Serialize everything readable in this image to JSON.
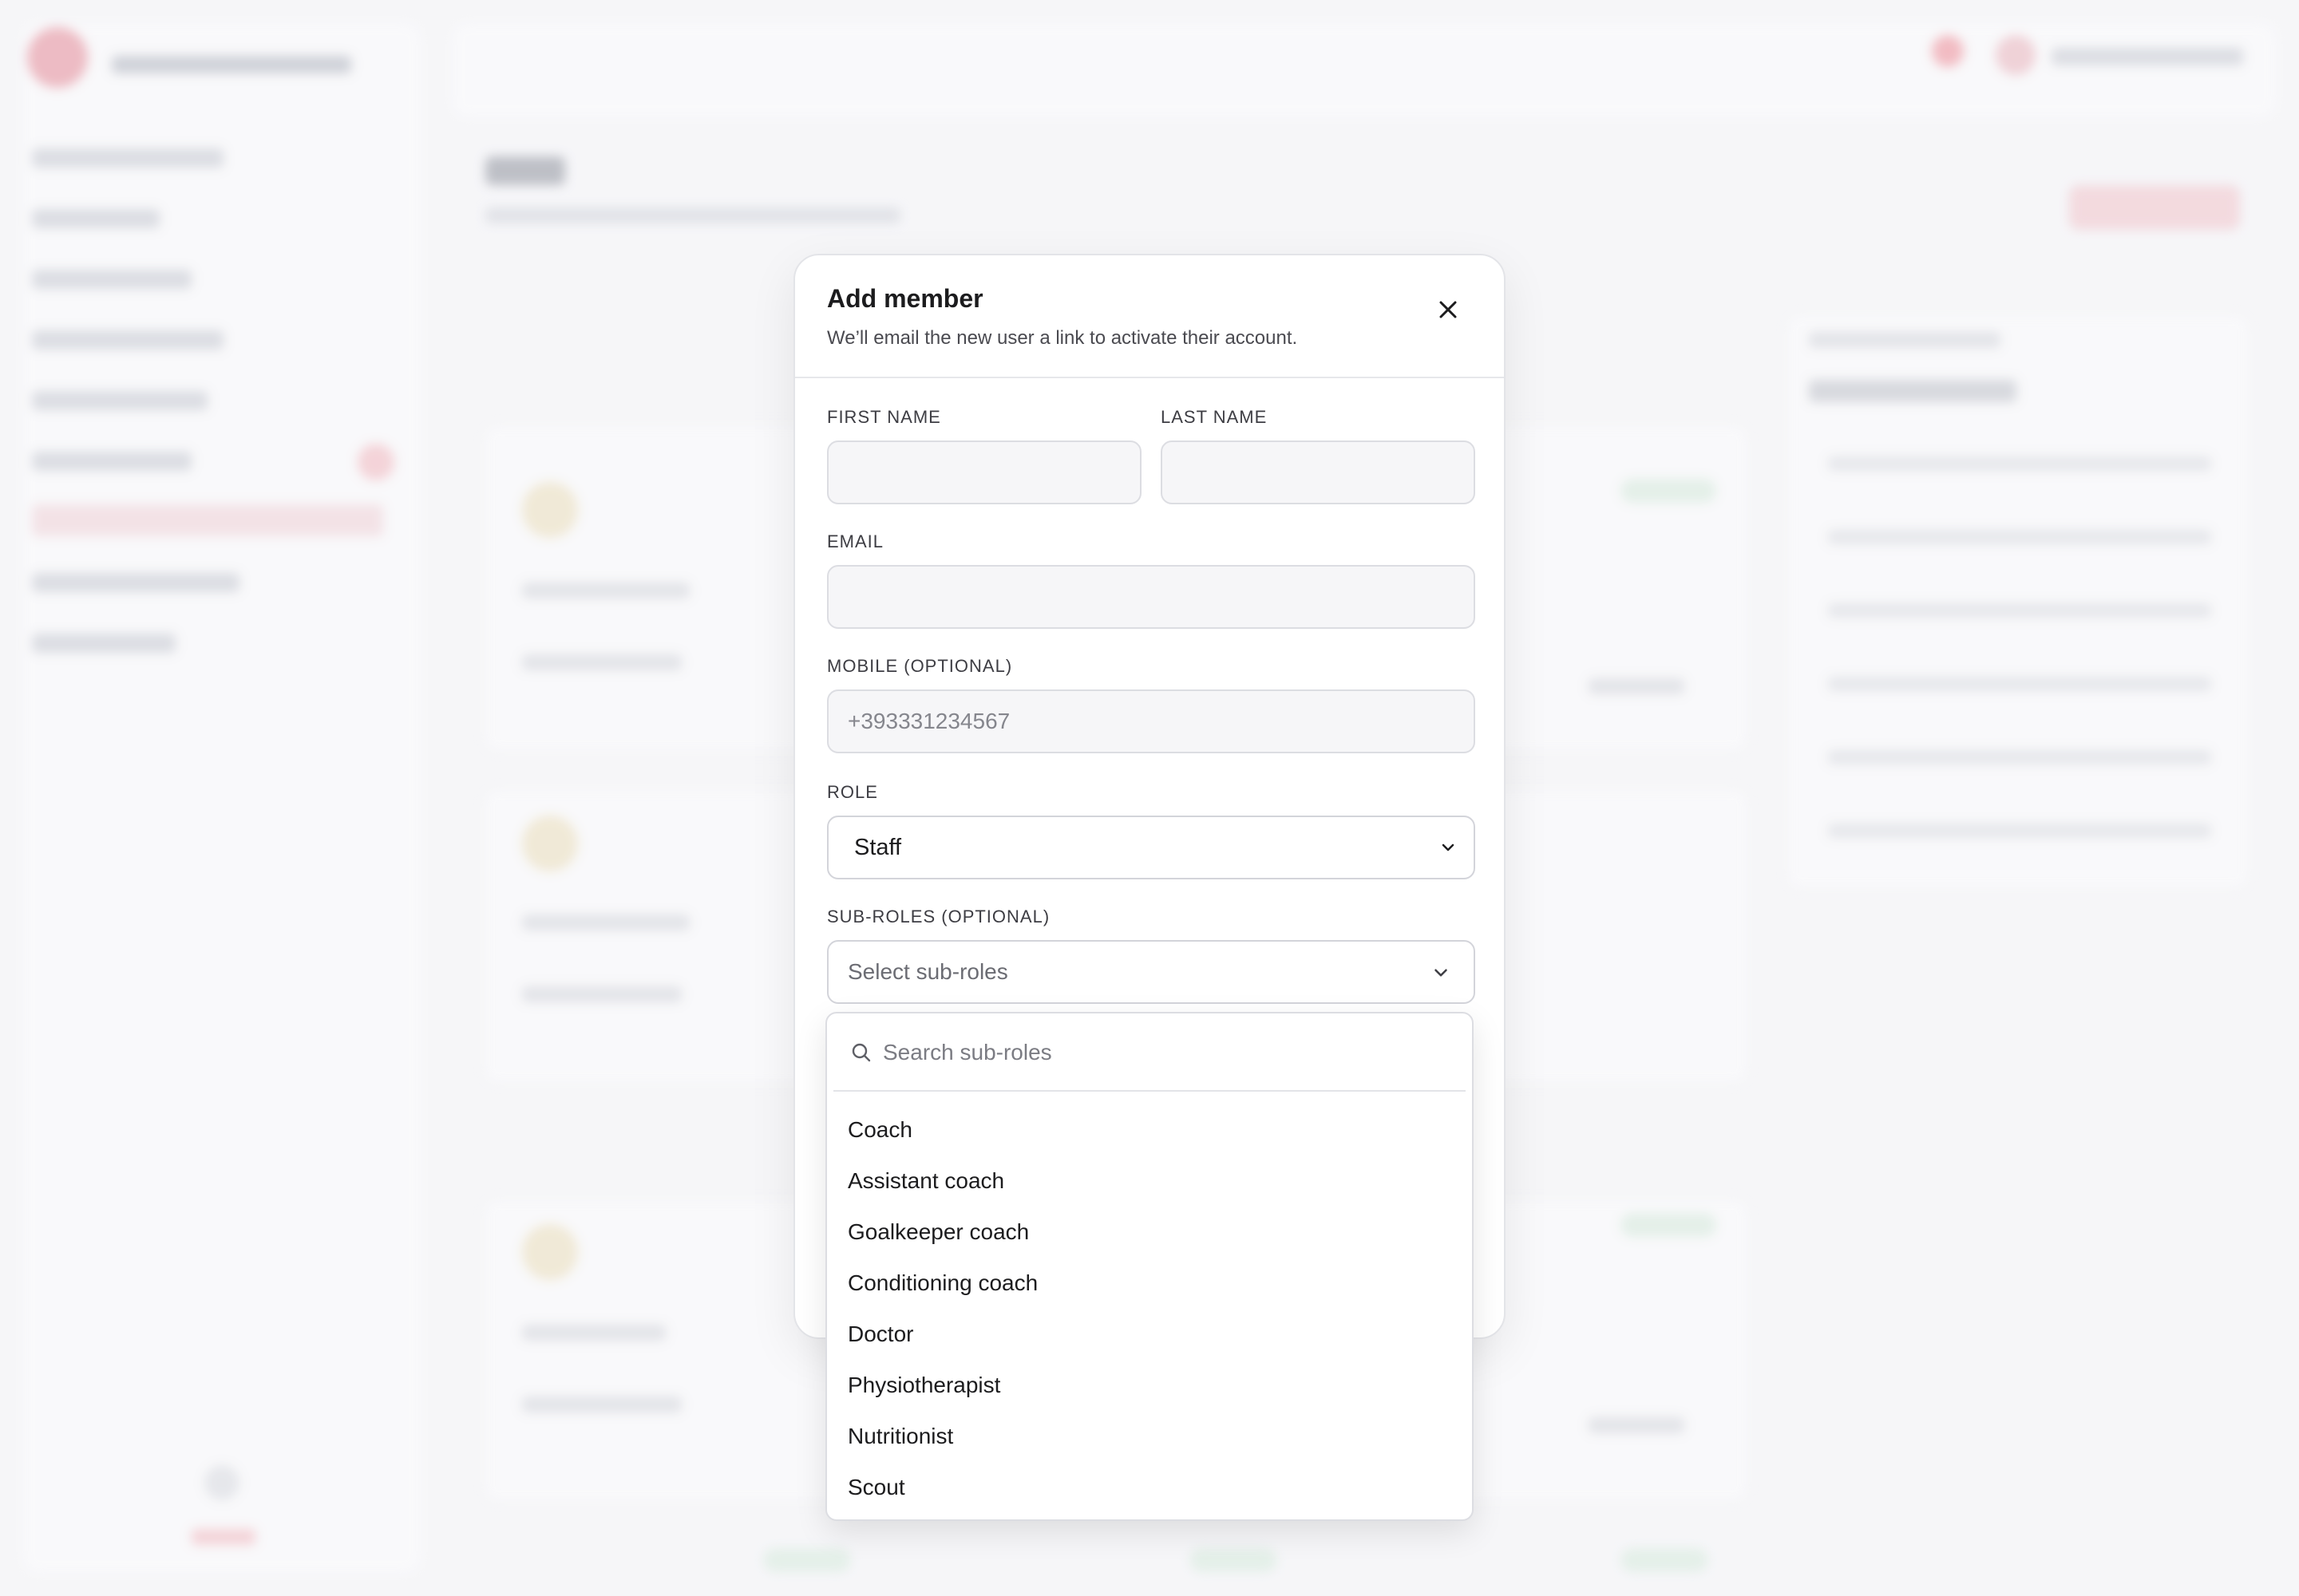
{
  "modal": {
    "title": "Add member",
    "subtitle": "We’ll email the new user a link to activate their account.",
    "fields": {
      "first_name": {
        "label": "FIRST NAME",
        "value": "",
        "placeholder": ""
      },
      "last_name": {
        "label": "LAST NAME",
        "value": "",
        "placeholder": ""
      },
      "email": {
        "label": "EMAIL",
        "value": "",
        "placeholder": ""
      },
      "mobile": {
        "label": "MOBILE (OPTIONAL)",
        "value": "",
        "placeholder": "+393331234567"
      },
      "role": {
        "label": "ROLE",
        "selected": "Staff"
      },
      "sub_roles": {
        "label": "SUB-ROLES (OPTIONAL)",
        "placeholder": "Select sub-roles"
      }
    }
  },
  "dropdown": {
    "search_placeholder": "Search sub-roles",
    "options": [
      "Coach",
      "Assistant coach",
      "Goalkeeper coach",
      "Conditioning coach",
      "Doctor",
      "Physiotherapist",
      "Nutritionist",
      "Scout"
    ]
  },
  "icons": {
    "close": "close-icon",
    "chevron": "chevron-down-icon",
    "search": "search-icon"
  },
  "colors": {
    "accent": "#e26a7a",
    "text": "#1c1c1e",
    "border": "#dcdde2"
  }
}
